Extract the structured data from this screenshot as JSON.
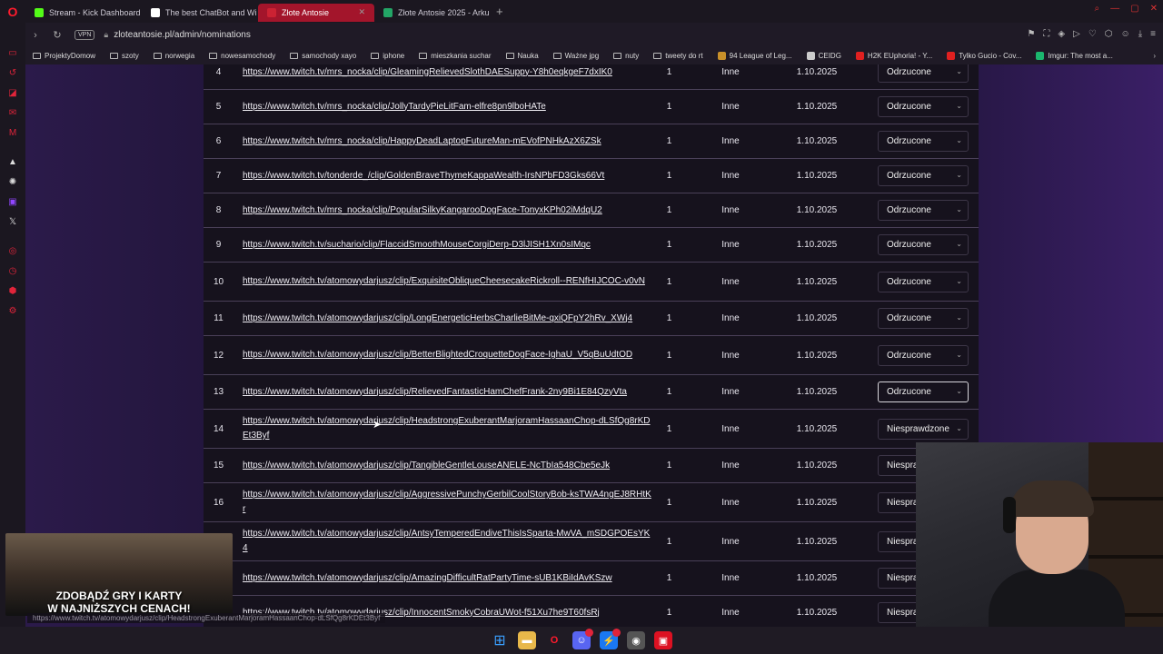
{
  "browser": {
    "tabs": [
      {
        "label": "Stream - Kick Dashboard",
        "color": "#53fc18",
        "active": false
      },
      {
        "label": "The best ChatBot and Wi",
        "color": "#ffffff",
        "active": false
      },
      {
        "label": "Złote Antosie",
        "color": "#cc2233",
        "active": true
      },
      {
        "label": "Złote Antosie 2025 - Arku",
        "color": "#23a566",
        "active": false
      }
    ],
    "new_tab": "+",
    "vpn_label": "VPN",
    "address": "zloteantosie.pl/admin/nominations",
    "bookmarks": [
      {
        "label": "ProjektyDomow",
        "type": "folder"
      },
      {
        "label": "szoty",
        "type": "folder"
      },
      {
        "label": "norwegia",
        "type": "folder"
      },
      {
        "label": "nowesamochody",
        "type": "folder"
      },
      {
        "label": "samochody xayo",
        "type": "folder"
      },
      {
        "label": "iphone",
        "type": "folder"
      },
      {
        "label": "mieszkania suchar",
        "type": "folder"
      },
      {
        "label": "Nauka",
        "type": "folder"
      },
      {
        "label": "Ważne jpg",
        "type": "folder"
      },
      {
        "label": "nuty",
        "type": "folder"
      },
      {
        "label": "tweety do rt",
        "type": "folder"
      },
      {
        "label": "94 League of Leg...",
        "type": "site",
        "color": "#c8902a"
      },
      {
        "label": "CEIDG",
        "type": "site",
        "color": "#cccccc"
      },
      {
        "label": "H2K EUphoria! - Y...",
        "type": "site",
        "color": "#e02020"
      },
      {
        "label": "Tylko Gucio - Cov...",
        "type": "site",
        "color": "#e02020"
      },
      {
        "label": "Imgur: The most a...",
        "type": "site",
        "color": "#1bb76e"
      }
    ]
  },
  "nominations": {
    "rows": [
      {
        "index": "4",
        "link": "https://www.twitch.tv/mrs_nocka/clip/GleamingRelievedSlothDAESuppy-Y8h0eqkgeF7dxIK0",
        "count": "1",
        "category": "Inne",
        "date": "1.10.2025",
        "status": "Odrzucone"
      },
      {
        "index": "5",
        "link": "https://www.twitch.tv/mrs_nocka/clip/JollyTardyPieLitFam-elfre8pn9lboHATe",
        "count": "1",
        "category": "Inne",
        "date": "1.10.2025",
        "status": "Odrzucone"
      },
      {
        "index": "6",
        "link": "https://www.twitch.tv/mrs_nocka/clip/HappyDeadLaptopFutureMan-mEVofPNHkAzX6ZSk",
        "count": "1",
        "category": "Inne",
        "date": "1.10.2025",
        "status": "Odrzucone"
      },
      {
        "index": "7",
        "link": "https://www.twitch.tv/tonderde_/clip/GoldenBraveThymeKappaWealth-IrsNPbFD3Gks66Vt",
        "count": "1",
        "category": "Inne",
        "date": "1.10.2025",
        "status": "Odrzucone"
      },
      {
        "index": "8",
        "link": "https://www.twitch.tv/mrs_nocka/clip/PopularSilkyKangarooDogFace-TonyxKPh02iMdqU2",
        "count": "1",
        "category": "Inne",
        "date": "1.10.2025",
        "status": "Odrzucone"
      },
      {
        "index": "9",
        "link": "https://www.twitch.tv/suchario/clip/FlaccidSmoothMouseCorgiDerp-D3lJISH1Xn0sIMqc",
        "count": "1",
        "category": "Inne",
        "date": "1.10.2025",
        "status": "Odrzucone"
      },
      {
        "index": "10",
        "link": "https://www.twitch.tv/atomowydarjusz/clip/ExquisiteObliqueCheesecakeRickroll--RENfHIJCOC-v0vN",
        "count": "1",
        "category": "Inne",
        "date": "1.10.2025",
        "status": "Odrzucone"
      },
      {
        "index": "11",
        "link": "https://www.twitch.tv/atomowydarjusz/clip/LongEnergeticHerbsCharlieBitMe-qxiQFpY2hRv_XWj4",
        "count": "1",
        "category": "Inne",
        "date": "1.10.2025",
        "status": "Odrzucone"
      },
      {
        "index": "12",
        "link": "https://www.twitch.tv/atomowydarjusz/clip/BetterBlightedCroquetteDogFace-IghaU_V5qBuUdtOD",
        "count": "1",
        "category": "Inne",
        "date": "1.10.2025",
        "status": "Odrzucone"
      },
      {
        "index": "13",
        "link": "https://www.twitch.tv/atomowydarjusz/clip/RelievedFantasticHamChefFrank-2ny9Bi1E84QzyVta",
        "count": "1",
        "category": "Inne",
        "date": "1.10.2025",
        "status": "Odrzucone",
        "focused": true
      },
      {
        "index": "14",
        "link": "https://www.twitch.tv/atomowydarjusz/clip/HeadstrongExuberantMarjoramHassaanChop-dLSfQg8rKDEt3Byf",
        "count": "1",
        "category": "Inne",
        "date": "1.10.2025",
        "status": "Niesprawdzone"
      },
      {
        "index": "15",
        "link": "https://www.twitch.tv/atomowydarjusz/clip/TangibleGentleLouseANELE-NcTbIa548Cbe5eJk",
        "count": "1",
        "category": "Inne",
        "date": "1.10.2025",
        "status": "Niespra"
      },
      {
        "index": "16",
        "link": "https://www.twitch.tv/atomowydarjusz/clip/AggressivePunchyGerbilCoolStoryBob-ksTWA4ngEJ8RHtKr",
        "count": "1",
        "category": "Inne",
        "date": "1.10.2025",
        "status": "Niespra"
      },
      {
        "index": "",
        "link": "https://www.twitch.tv/atomowydarjusz/clip/AntsyTemperedEndiveThisIsSparta-MwVA_mSDGPOEsYK4",
        "count": "1",
        "category": "Inne",
        "date": "1.10.2025",
        "status": "Niespra"
      },
      {
        "index": "",
        "link": "https://www.twitch.tv/atomowydarjusz/clip/AmazingDifficultRatPartyTime-sUB1KBiIdAvKSzw",
        "count": "1",
        "category": "Inne",
        "date": "1.10.2025",
        "status": "Niespra"
      },
      {
        "index": "",
        "link": "https://www.twitch.tv/atomowydarjusz/clip/InnocentSmokyCobraUWot-f51Xu7he9T60fsRj",
        "count": "1",
        "category": "Inne",
        "date": "1.10.2025",
        "status": "Niespra"
      }
    ]
  },
  "overlay": {
    "ad_line1": "ZDOBĄDŹ GRY I KARTY",
    "ad_line2": "W NAJNIŻSZYCH CENACH!",
    "status_url": "https://www.twitch.tv/atomowydarjusz/clip/HeadstrongExuberantMarjoramHassaanChop-dLSfQg8rKDEt3Byf"
  }
}
